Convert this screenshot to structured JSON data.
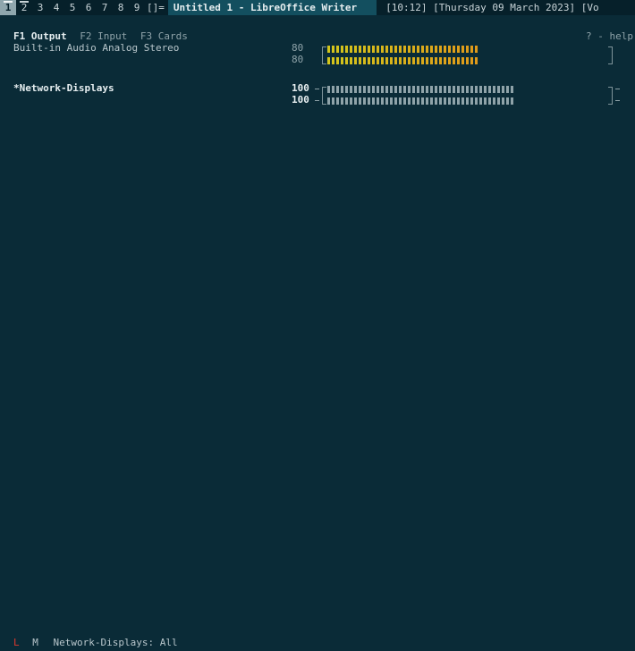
{
  "topbar": {
    "workspaces": [
      {
        "label": "1",
        "active": true,
        "occupied": true
      },
      {
        "label": "2",
        "active": false,
        "occupied": true
      },
      {
        "label": "3",
        "active": false,
        "occupied": false
      },
      {
        "label": "4",
        "active": false,
        "occupied": false
      },
      {
        "label": "5",
        "active": false,
        "occupied": false
      },
      {
        "label": "6",
        "active": false,
        "occupied": false
      },
      {
        "label": "7",
        "active": false,
        "occupied": false
      },
      {
        "label": "8",
        "active": false,
        "occupied": false
      },
      {
        "label": "9",
        "active": false,
        "occupied": false
      }
    ],
    "layout_symbol": "[]=",
    "window_title": "Untitled 1 - LibreOffice Writer",
    "status": "[10:12] [Thursday 09 March 2023] [Vo"
  },
  "tabs": [
    {
      "label": "F1 Output",
      "active": true
    },
    {
      "label": "F2 Input",
      "active": false
    },
    {
      "label": "F3 Cards",
      "active": false
    }
  ],
  "help": "? - help",
  "devices": [
    {
      "name": "Built-in Audio Analog Stereo",
      "selected": false,
      "channels": [
        {
          "volume": "80",
          "level": 0.8
        },
        {
          "volume": "80",
          "level": 0.8
        }
      ],
      "fill_color": "#d3c61c",
      "fill_color_end": "#e09a1a",
      "dash_color": "#c9a33a",
      "dash_color_end": "#d0452a"
    },
    {
      "name": "*Network-Displays",
      "selected": true,
      "channels": [
        {
          "volume": "100",
          "level": 1.0
        },
        {
          "volume": "100",
          "level": 1.0
        }
      ],
      "fill_color": "#8fa3a9",
      "fill_color_end": "#8fa3a9",
      "dash_color": "#e0522a",
      "dash_color_end": "#e0522a"
    }
  ],
  "bottombar": {
    "lock": "L",
    "mute": "M",
    "filter": "Network-Displays: All"
  }
}
